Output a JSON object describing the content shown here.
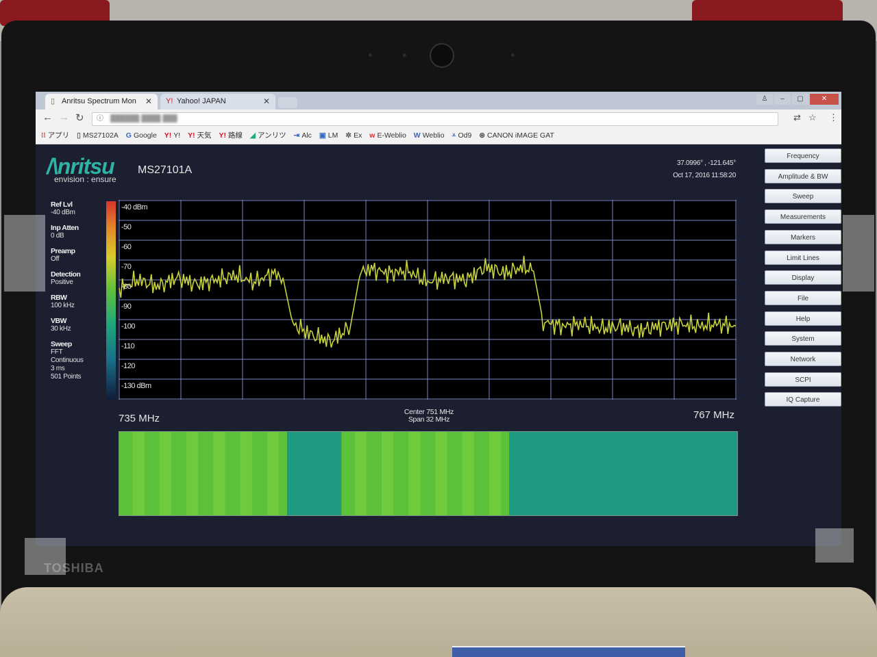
{
  "browser": {
    "tabs": [
      {
        "label": "Anritsu Spectrum Mon",
        "icon": "page-icon"
      },
      {
        "label": "Yahoo! JAPAN",
        "icon": "yahoo-icon"
      }
    ],
    "bookmarks": [
      {
        "label": "アプリ",
        "icon": "apps-grid-icon"
      },
      {
        "label": "MS27102A",
        "icon": "page-icon"
      },
      {
        "label": "Google",
        "icon": "google-icon"
      },
      {
        "label": "Y!",
        "icon": "yahoo-icon"
      },
      {
        "label": "天気",
        "icon": "yahoo-icon"
      },
      {
        "label": "路線",
        "icon": "yahoo-icon"
      },
      {
        "label": "アンリツ",
        "icon": "anritsu-icon"
      },
      {
        "label": "Alc",
        "icon": "alc-icon"
      },
      {
        "label": "LM",
        "icon": "lm-icon"
      },
      {
        "label": "Ex",
        "icon": "ex-icon"
      },
      {
        "label": "E-Weblio",
        "icon": "weblio-icon"
      },
      {
        "label": "Weblio",
        "icon": "weblio-icon"
      },
      {
        "label": "Od9",
        "icon": "od9-icon"
      },
      {
        "label": "CANON iMAGE GAT",
        "icon": "canon-icon"
      }
    ]
  },
  "instrument": {
    "logo": "/\\nritsu",
    "tagline": "envision : ensure",
    "model": "MS27101A",
    "gps": "37.0996° , -121.645°",
    "datetime": "Oct 17, 2016 11:58:20",
    "brand": "TOSHIBA"
  },
  "params": [
    {
      "label": "Ref Lvl",
      "value": "-40 dBm"
    },
    {
      "label": "Inp Atten",
      "value": "0 dB"
    },
    {
      "label": "Preamp",
      "value": "Off"
    },
    {
      "label": "Detection",
      "value": "Positive"
    },
    {
      "label": "RBW",
      "value": "100 kHz"
    },
    {
      "label": "VBW",
      "value": "30 kHz"
    },
    {
      "label": "Sweep",
      "value": "FFT\nContinuous\n3 ms\n501 Points"
    }
  ],
  "menu": [
    "Frequency",
    "Amplitude & BW",
    "Sweep",
    "Measurements",
    "Markers",
    "Limit Lines",
    "Display",
    "File",
    "Help",
    "System",
    "Network",
    "SCPI",
    "IQ Capture"
  ],
  "chart_data": {
    "type": "line",
    "title": "",
    "xlabel": "",
    "ylabel": "",
    "x_start_label": "735 MHz",
    "x_end_label": "767 MHz",
    "center_label": "Center 751  MHz",
    "span_label": "Span 32 MHz",
    "y_tick_labels": [
      "-40 dBm",
      "-50",
      "-60",
      "-70",
      "-80",
      "-90",
      "-100",
      "-110",
      "-120",
      "-130 dBm"
    ],
    "ylim": [
      -130,
      -40
    ],
    "xlim": [
      735,
      767
    ],
    "series": [
      {
        "x": [
          735,
          736,
          737,
          738,
          739,
          740,
          741,
          742,
          743,
          743.5,
          744,
          745,
          746,
          747,
          747.5,
          748,
          749,
          750,
          751,
          752,
          753,
          754,
          755,
          756,
          756.5,
          757,
          758,
          759,
          760,
          761,
          762,
          763,
          764,
          765,
          766,
          767
        ],
        "values": [
          -80,
          -76,
          -79,
          -75,
          -78,
          -76,
          -74,
          -77,
          -73,
          -75,
          -96,
          -101,
          -104,
          -97,
          -73,
          -71,
          -73,
          -72,
          -77,
          -75,
          -76,
          -70,
          -73,
          -70,
          -72,
          -95,
          -97,
          -96,
          -98,
          -97,
          -99,
          -97,
          -96,
          -97,
          -96,
          -97
        ]
      }
    ],
    "spectrogram_bands": [
      {
        "from": 735,
        "to": 743.7,
        "level": "high"
      },
      {
        "from": 743.7,
        "to": 746.5,
        "level": "low"
      },
      {
        "from": 746.5,
        "to": 755.2,
        "level": "high"
      },
      {
        "from": 755.2,
        "to": 767,
        "level": "low"
      }
    ],
    "grid": true,
    "trace_color": "#c8d23a"
  }
}
